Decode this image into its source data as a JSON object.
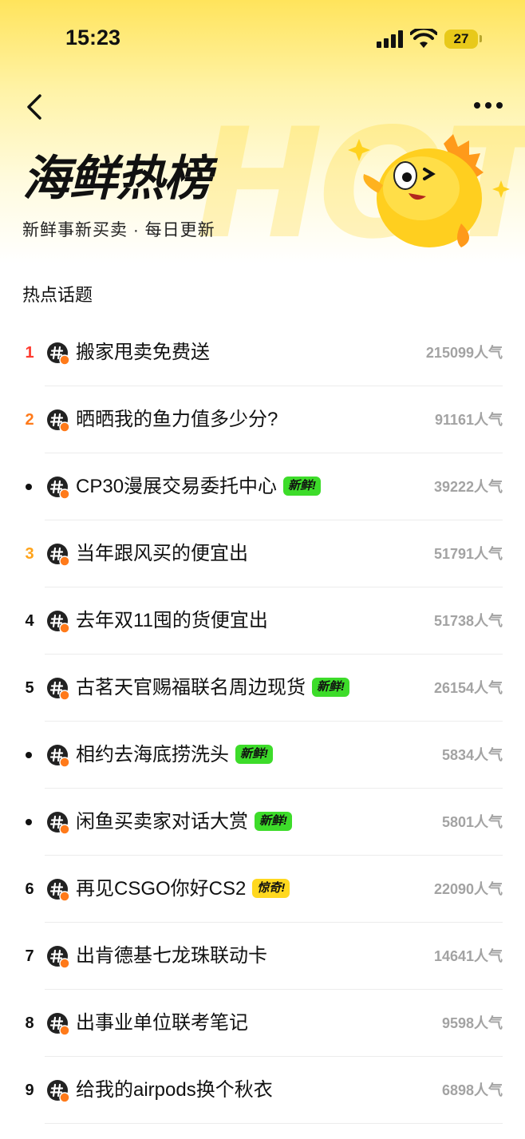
{
  "status_bar": {
    "time": "15:23",
    "battery": "27"
  },
  "header": {
    "watermark": "HOT",
    "title": "海鲜热榜",
    "subtitle": "新鲜事新买卖 · 每日更新"
  },
  "section": {
    "title": "热点话题"
  },
  "colors": {
    "rank1": "#ff3b2f",
    "rank2": "#ff7a1a",
    "rank3": "#ffa31a",
    "badge_new": "#3ddc2a",
    "badge_wow": "#ffd81f",
    "accent": "#ffe45c"
  },
  "topics": [
    {
      "rank": "1",
      "title": "搬家甩卖免费送",
      "badge": "",
      "heat": "215099人气"
    },
    {
      "rank": "2",
      "title": "晒晒我的鱼力值多少分?",
      "badge": "",
      "heat": "91161人气"
    },
    {
      "rank": "",
      "title": "CP30漫展交易委托中心",
      "badge": "新鲜!",
      "badge_type": "new",
      "heat": "39222人气"
    },
    {
      "rank": "3",
      "title": "当年跟风买的便宜出",
      "badge": "",
      "heat": "51791人气"
    },
    {
      "rank": "4",
      "title": "去年双11囤的货便宜出",
      "badge": "",
      "heat": "51738人气"
    },
    {
      "rank": "5",
      "title": "古茗天官赐福联名周边现货",
      "badge": "新鲜!",
      "badge_type": "new",
      "heat": "26154人气"
    },
    {
      "rank": "",
      "title": "相约去海底捞洗头",
      "badge": "新鲜!",
      "badge_type": "new",
      "heat": "5834人气"
    },
    {
      "rank": "",
      "title": "闲鱼买卖家对话大赏",
      "badge": "新鲜!",
      "badge_type": "new",
      "heat": "5801人气"
    },
    {
      "rank": "6",
      "title": "再见CSGO你好CS2",
      "badge": "惊奇!",
      "badge_type": "wow",
      "heat": "22090人气"
    },
    {
      "rank": "7",
      "title": "出肯德基七龙珠联动卡",
      "badge": "",
      "heat": "14641人气"
    },
    {
      "rank": "8",
      "title": "出事业单位联考笔记",
      "badge": "",
      "heat": "9598人气"
    },
    {
      "rank": "9",
      "title": "给我的airpods换个秋衣",
      "badge": "",
      "heat": "6898人气"
    }
  ]
}
